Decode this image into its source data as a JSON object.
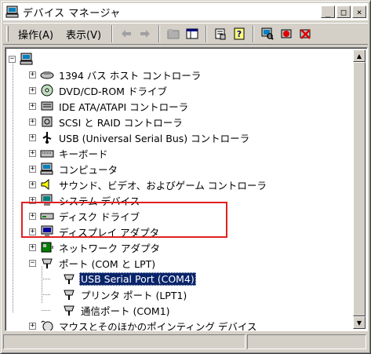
{
  "window": {
    "title": "デバイス マネージャ",
    "buttons": {
      "minimize": "_",
      "maximize": "□",
      "close": "×"
    }
  },
  "menu": {
    "action": "操作(A)",
    "view": "表示(V)"
  },
  "tree": {
    "root": "",
    "items": [
      {
        "label": "1394 バス ホスト コントローラ",
        "icon": "bus-icon"
      },
      {
        "label": "DVD/CD-ROM ドライブ",
        "icon": "cdrom-icon"
      },
      {
        "label": "IDE ATA/ATAPI コントローラ",
        "icon": "ide-icon"
      },
      {
        "label": "SCSI と RAID コントローラ",
        "icon": "scsi-icon"
      },
      {
        "label": "USB (Universal Serial Bus) コントローラ",
        "icon": "usb-icon"
      },
      {
        "label": "キーボード",
        "icon": "keyboard-icon"
      },
      {
        "label": "コンピュータ",
        "icon": "computer-icon"
      },
      {
        "label": "サウンド、ビデオ、およびゲーム コントローラ",
        "icon": "sound-icon"
      },
      {
        "label": "システム デバイス",
        "icon": "system-icon"
      },
      {
        "label": "ディスク ドライブ",
        "icon": "disk-icon"
      },
      {
        "label": "ディスプレイ アダプタ",
        "icon": "display-icon"
      },
      {
        "label": "ネットワーク アダプタ",
        "icon": "network-icon"
      },
      {
        "label": "ポート (COM と LPT)",
        "icon": "port-icon"
      },
      {
        "label": "USB Serial Port (COM4)",
        "icon": "port-icon"
      },
      {
        "label": "プリンタ ポート (LPT1)",
        "icon": "port-icon"
      },
      {
        "label": "通信ポート (COM1)",
        "icon": "port-icon"
      },
      {
        "label": "マウスとそのほかのポインティング デバイス",
        "icon": "mouse-icon"
      }
    ]
  },
  "colors": {
    "selection": "#0a246a",
    "highlight_box": "#e02020",
    "chrome": "#d4d0c8"
  }
}
